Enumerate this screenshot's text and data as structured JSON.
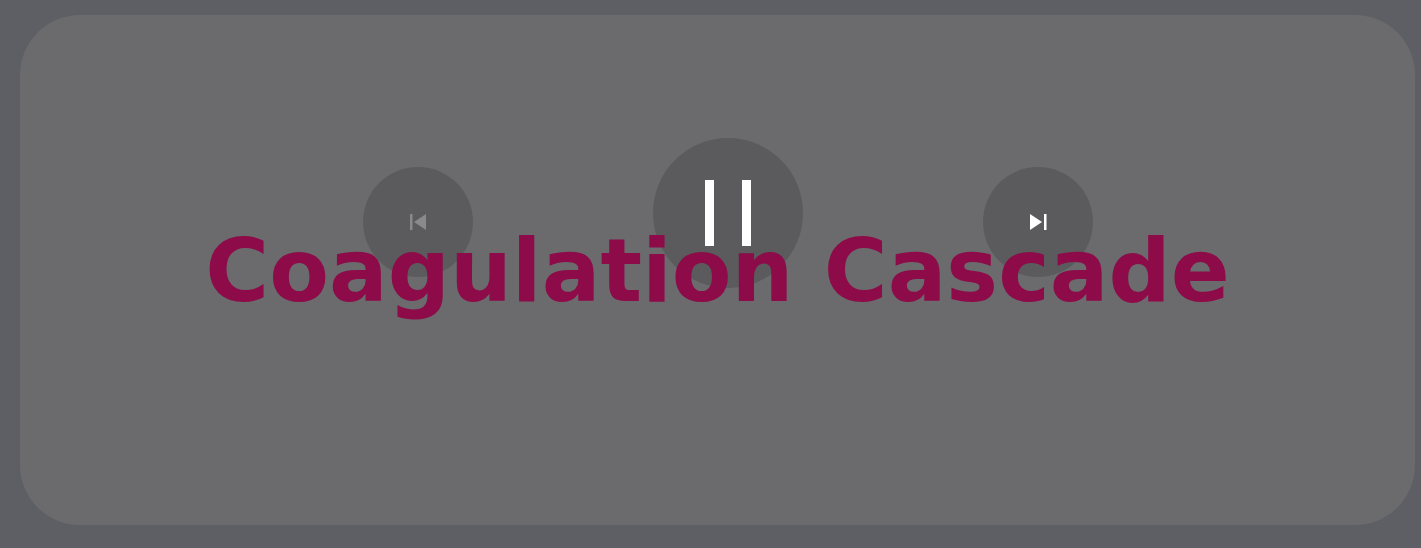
{
  "player": {
    "playing": true,
    "previous": {
      "disabled": true
    },
    "next": {
      "disabled": false
    }
  },
  "slide": {
    "title": "Coagulation Cascade"
  }
}
